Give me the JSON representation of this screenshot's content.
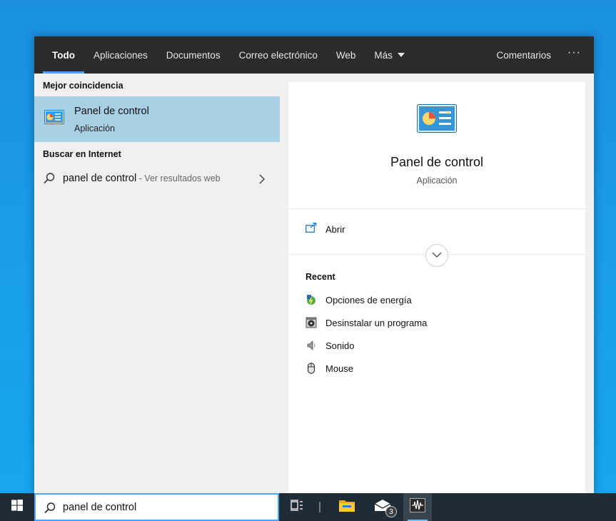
{
  "tabs": [
    {
      "label": "Todo",
      "active": true
    },
    {
      "label": "Aplicaciones"
    },
    {
      "label": "Documentos"
    },
    {
      "label": "Correo electrónico"
    },
    {
      "label": "Web"
    },
    {
      "label": "Más"
    }
  ],
  "header_right": {
    "feedback": "Comentarios",
    "more": "···"
  },
  "left": {
    "best_match_title": "Mejor coincidencia",
    "best_match": {
      "title": "Panel de control",
      "subtitle": "Aplicación",
      "icon": "control-panel-icon"
    },
    "web_section_title": "Buscar en Internet",
    "web_result": {
      "query": "panel de control",
      "suffix": " - Ver resultados web"
    }
  },
  "right": {
    "app_name": "Panel de control",
    "app_type": "Aplicación",
    "actions": [
      {
        "label": "Abrir",
        "icon": "open-icon"
      }
    ],
    "recent_title": "Recent",
    "recent": [
      {
        "label": "Opciones de energía",
        "icon": "power-options-icon"
      },
      {
        "label": "Desinstalar un programa",
        "icon": "uninstall-program-icon"
      },
      {
        "label": "Sonido",
        "icon": "sound-icon"
      },
      {
        "label": "Mouse",
        "icon": "mouse-icon"
      }
    ]
  },
  "taskbar": {
    "search_value": "panel de control",
    "mail_badge": "3",
    "accent": "#4da3ff"
  }
}
